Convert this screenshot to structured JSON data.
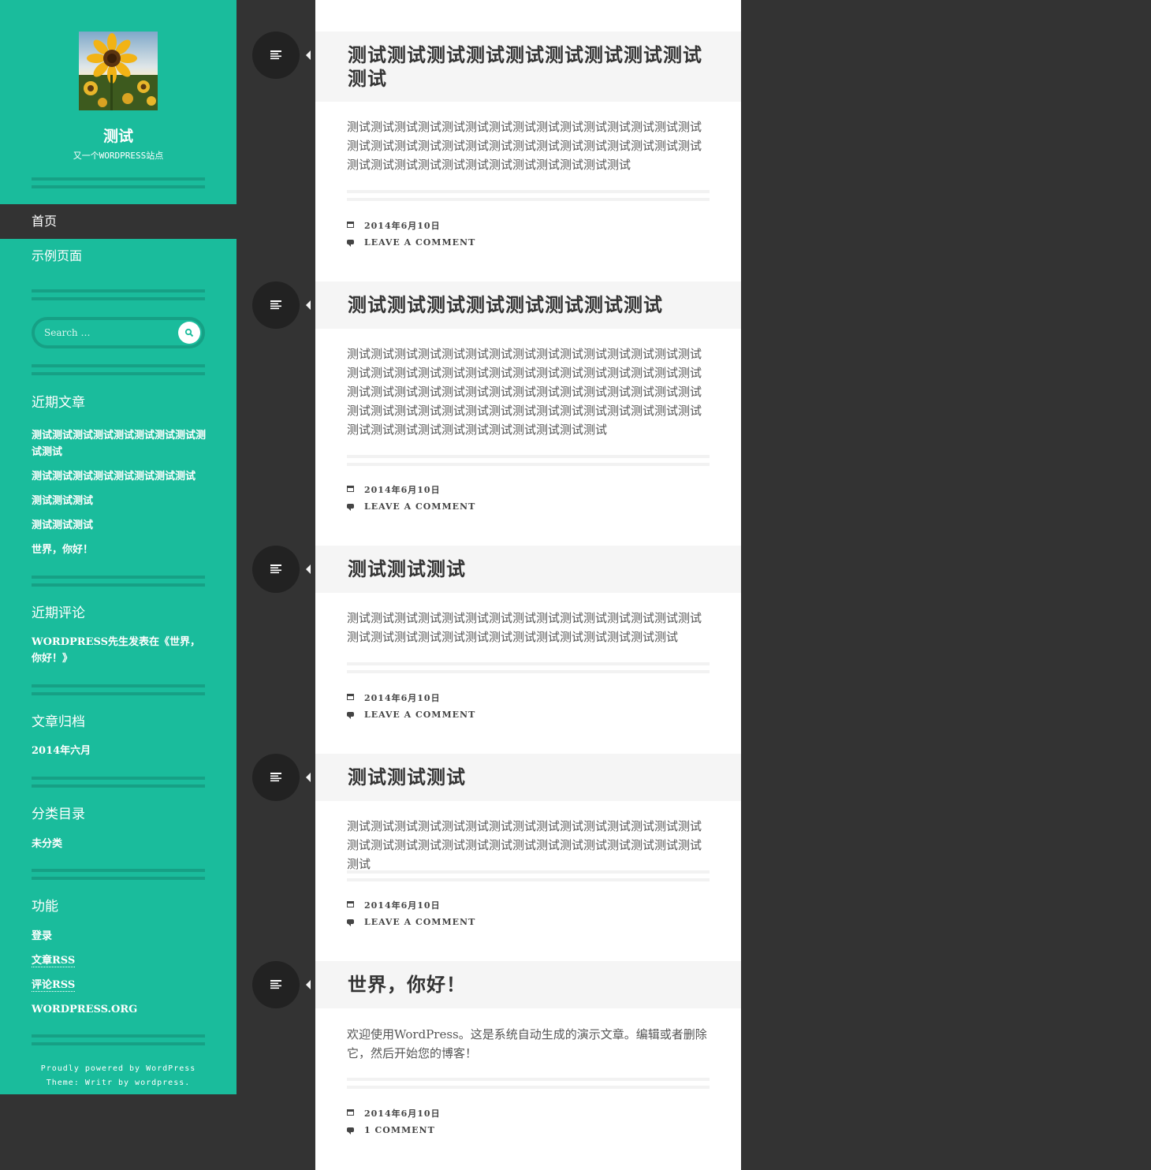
{
  "site": {
    "title": "测试",
    "description": "又一个WORDPRESS站点"
  },
  "nav": [
    {
      "label": "首页",
      "active": true
    },
    {
      "label": "示例页面",
      "active": false
    }
  ],
  "search": {
    "placeholder": "Search …"
  },
  "widgets": {
    "recent_posts": {
      "title": "近期文章",
      "items": [
        "测试测试测试测试测试测试测试测试测试测试",
        "测试测试测试测试测试测试测试测试",
        "测试测试测试",
        "测试测试测试",
        "世界，你好！"
      ]
    },
    "recent_comments": {
      "title": "近期评论",
      "items": [
        "WORDPRESS先生发表在《世界，你好！》"
      ]
    },
    "archives": {
      "title": "文章归档",
      "items": [
        "2014年六月"
      ]
    },
    "categories": {
      "title": "分类目录",
      "items": [
        "未分类"
      ]
    },
    "meta": {
      "title": "功能",
      "items": [
        "登录",
        "文章RSS",
        "评论RSS",
        "WORDPRESS.ORG"
      ]
    }
  },
  "credits": {
    "line1": "Proudly powered by WordPress",
    "line2": "Theme: Writr by wordpress."
  },
  "posts": [
    {
      "title": "测试测试测试测试测试测试测试测试测试测试",
      "body": "测试测试测试测试测试测试测试测试测试测试测试测试测试测试测试测试测试测试测试测试测试测试测试测试测试测试测试测试测试测试测试测试测试测试测试测试测试测试测试测试测试测试",
      "date": "2014年6月10日",
      "comments": "LEAVE A COMMENT"
    },
    {
      "title": "测试测试测试测试测试测试测试测试",
      "body": "测试测试测试测试测试测试测试测试测试测试测试测试测试测试测试测试测试测试测试测试测试测试测试测试测试测试测试测试测试测试测试测试测试测试测试测试测试测试测试测试测试测试测试测试测试测试测试测试测试测试测试测试测试测试测试测试测试测试测试测试测试测试测试测试测试测试测试测试测试测试测试",
      "date": "2014年6月10日",
      "comments": "LEAVE A COMMENT"
    },
    {
      "title": "测试测试测试",
      "body": "测试测试测试测试测试测试测试测试测试测试测试测试测试测试测试测试测试测试测试测试测试测试测试测试测试测试测试测试测试",
      "date": "2014年6月10日",
      "comments": "LEAVE A COMMENT"
    },
    {
      "title": "测试测试测试",
      "body": "测试测试测试测试测试测试测试测试测试测试测试测试测试测试测试测试测试测试测试测试测试测试测试测试测试测试测试测试测试测试测试",
      "date": "2014年6月10日",
      "comments": "LEAVE A COMMENT"
    },
    {
      "title": "世界，你好！",
      "body": "欢迎使用WordPress。这是系统自动生成的演示文章。编辑或者删除它，然后开始您的博客！",
      "date": "2014年6月10日",
      "comments": "1 COMMENT"
    }
  ],
  "icons": {
    "post_format": "standard-post-format-icon",
    "date": "calendar-icon",
    "comments": "comment-bubble-icon",
    "search": "search-icon"
  },
  "colors": {
    "sidebar": "#1abc9c",
    "sidebar_accent": "#16a085",
    "background": "#333333",
    "main": "#ffffff",
    "title_band": "#f5f5f5",
    "dot": "#222222"
  }
}
